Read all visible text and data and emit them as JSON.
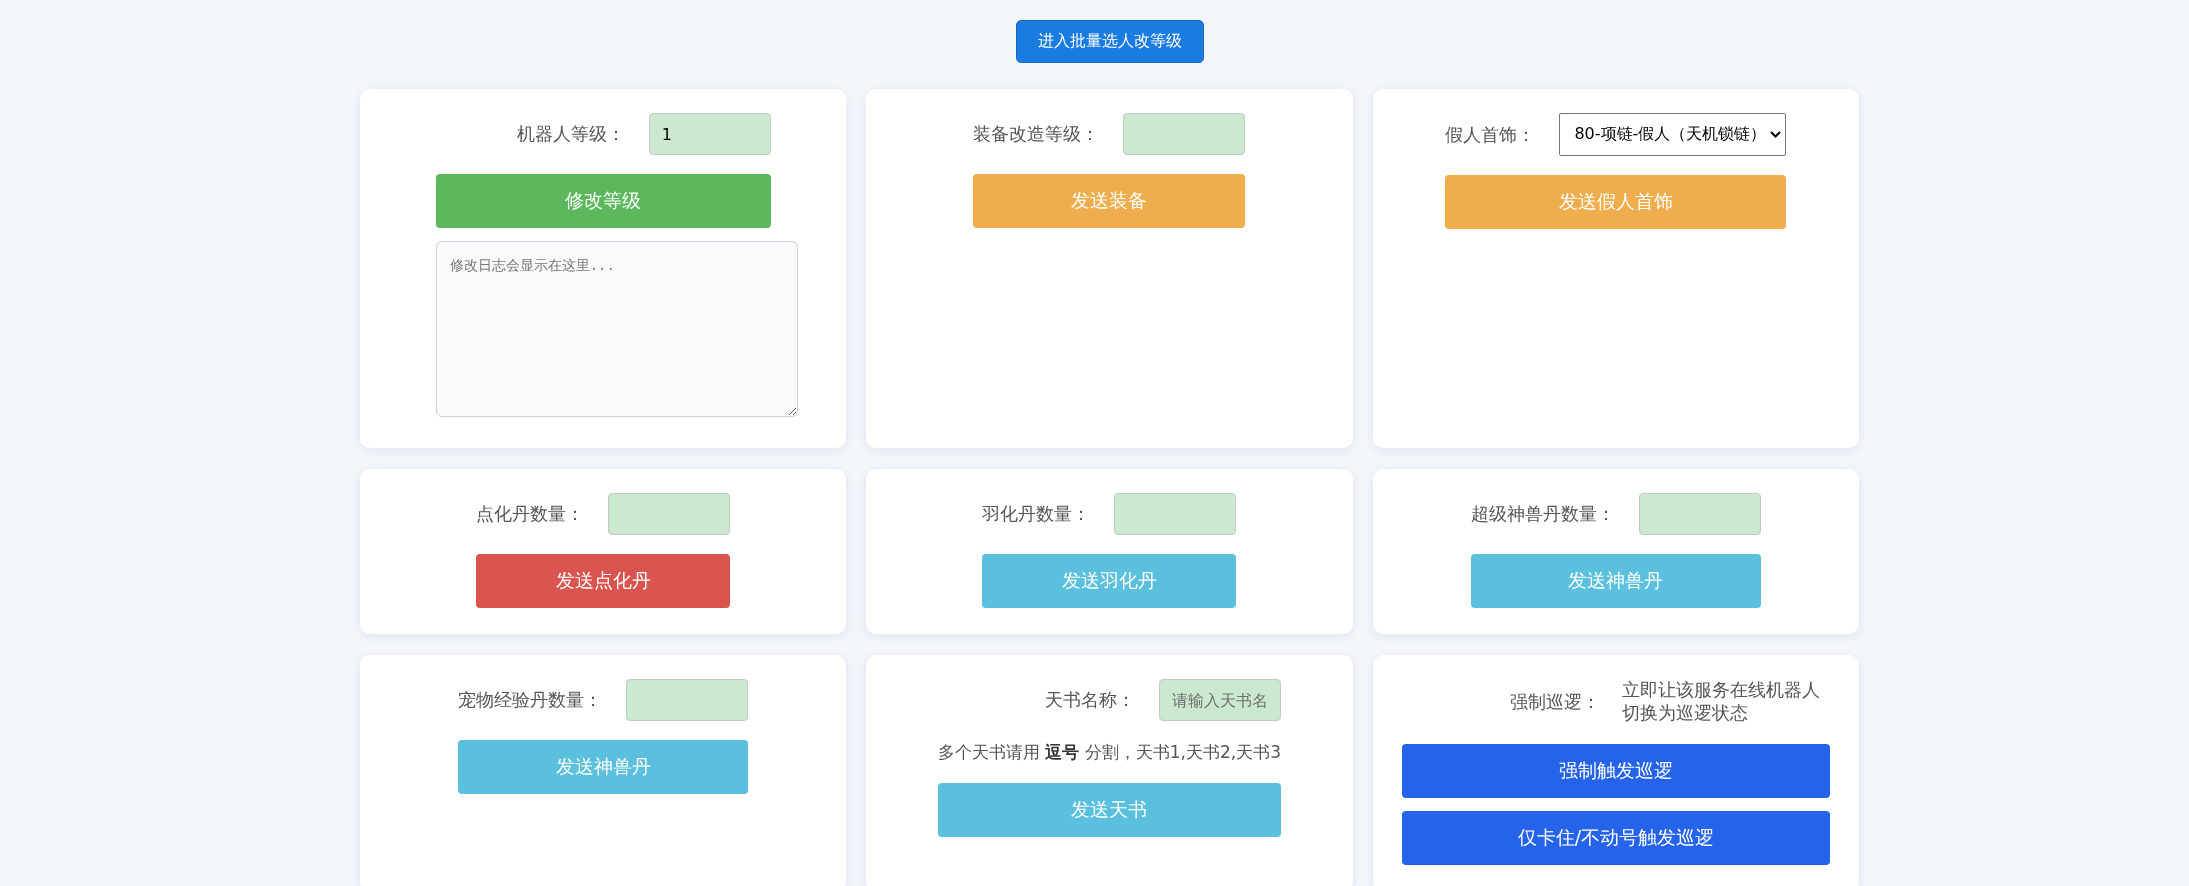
{
  "top_button": {
    "label": "进入批量选人改等级"
  },
  "cards": [
    {
      "kind": "level",
      "label": "机器人等级：",
      "input": {
        "value": "1"
      },
      "buttons": [
        {
          "label": "修改等级",
          "color": "#5cb85c"
        }
      ],
      "log": {
        "placeholder": "修改日志会显示在这里..."
      }
    },
    {
      "kind": "field",
      "label": "装备改造等级：",
      "buttons": [
        {
          "label": "发送装备",
          "color": "#f0ad4e"
        }
      ]
    },
    {
      "kind": "select",
      "label": "假人首饰：",
      "select": {
        "value": "80-项链-假人（天机锁链）"
      },
      "buttons": [
        {
          "label": "发送假人首饰",
          "color": "#f0ad4e"
        }
      ]
    },
    {
      "kind": "field",
      "label": "点化丹数量：",
      "buttons": [
        {
          "label": "发送点化丹",
          "color": "#d9534f"
        }
      ]
    },
    {
      "kind": "field",
      "label": "羽化丹数量：",
      "buttons": [
        {
          "label": "发送羽化丹",
          "color": "#5bc0de"
        }
      ]
    },
    {
      "kind": "field",
      "label": "超级神兽丹数量：",
      "buttons": [
        {
          "label": "发送神兽丹",
          "color": "#5bc0de"
        }
      ]
    },
    {
      "kind": "field",
      "label": "宠物经验丹数量：",
      "buttons": [
        {
          "label": "发送神兽丹",
          "color": "#5bc0de"
        }
      ]
    },
    {
      "kind": "hint",
      "label": "天书名称：",
      "input": {
        "placeholder": "请输入天书名"
      },
      "hint": "多个天书请用 **逗号** 分割，天书1,天书2,天书3",
      "buttons": [
        {
          "label": "发送天书",
          "color": "#5bc0de"
        }
      ]
    },
    {
      "kind": "patrol",
      "label": "强制巡逻：",
      "description": "立即让该服务在线机器人切换为巡逻状态",
      "buttons": [
        {
          "label": "强制触发巡逻",
          "color": "#2563eb"
        },
        {
          "label": "仅卡住/不动号触发巡逻",
          "color": "#2563eb"
        }
      ]
    }
  ]
}
